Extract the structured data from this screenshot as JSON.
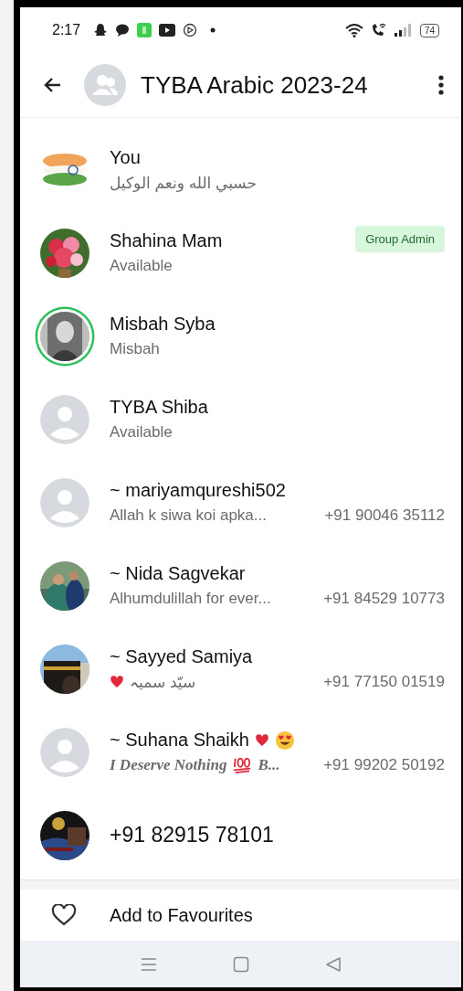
{
  "status_bar": {
    "time": "2:17",
    "battery": "74"
  },
  "header": {
    "title": "TYBA Arabic 2023-24"
  },
  "participants": [
    {
      "name": "You",
      "about": "حسبي الله ونعم الوكيل",
      "avatar": {
        "kind": "picture"
      },
      "ring": false
    },
    {
      "name": "Shahina Mam",
      "about": "Available",
      "avatar": {
        "kind": "picture"
      },
      "ring": false,
      "badge": "Group Admin"
    },
    {
      "name": "Misbah Syba",
      "about": "Misbah",
      "avatar": {
        "kind": "picture"
      },
      "ring": true
    },
    {
      "name": "TYBA Shiba",
      "about": "Available",
      "avatar": {
        "kind": "default"
      },
      "ring": false
    },
    {
      "name": "~ mariyamqureshi502",
      "about": "Allah k siwa koi apka...",
      "phone": "+91 90046 35112",
      "avatar": {
        "kind": "default"
      },
      "ring": false
    },
    {
      "name": "~ Nida Sagvekar",
      "about": "Alhumdulillah for ever...",
      "phone": "+91 84529 10773",
      "avatar": {
        "kind": "picture"
      },
      "ring": false
    },
    {
      "name": "~ Sayyed Samiya",
      "about_parts": [
        {
          "kind": "heart"
        },
        {
          "kind": "text",
          "text": "سیّد سمیہ"
        }
      ],
      "phone": "+91 77150 01519",
      "avatar": {
        "kind": "picture"
      },
      "ring": false
    },
    {
      "name": "~ Suhana Shaikh",
      "name_emojis": [
        {
          "kind": "heart"
        },
        {
          "kind": "smiley"
        }
      ],
      "about_style": {
        "kind": "fancy"
      },
      "about_parts": [
        {
          "kind": "text",
          "text": "I Deserve Nothing"
        },
        {
          "kind": "hundred"
        },
        {
          "kind": "text",
          "text": "B..."
        }
      ],
      "phone": "+91 99202 50192",
      "avatar": {
        "kind": "default"
      },
      "ring": false
    },
    {
      "name": "+91 82915 78101",
      "avatar": {
        "kind": "picture"
      },
      "ring": false
    }
  ],
  "favourites": {
    "label": "Add to Favourites"
  }
}
